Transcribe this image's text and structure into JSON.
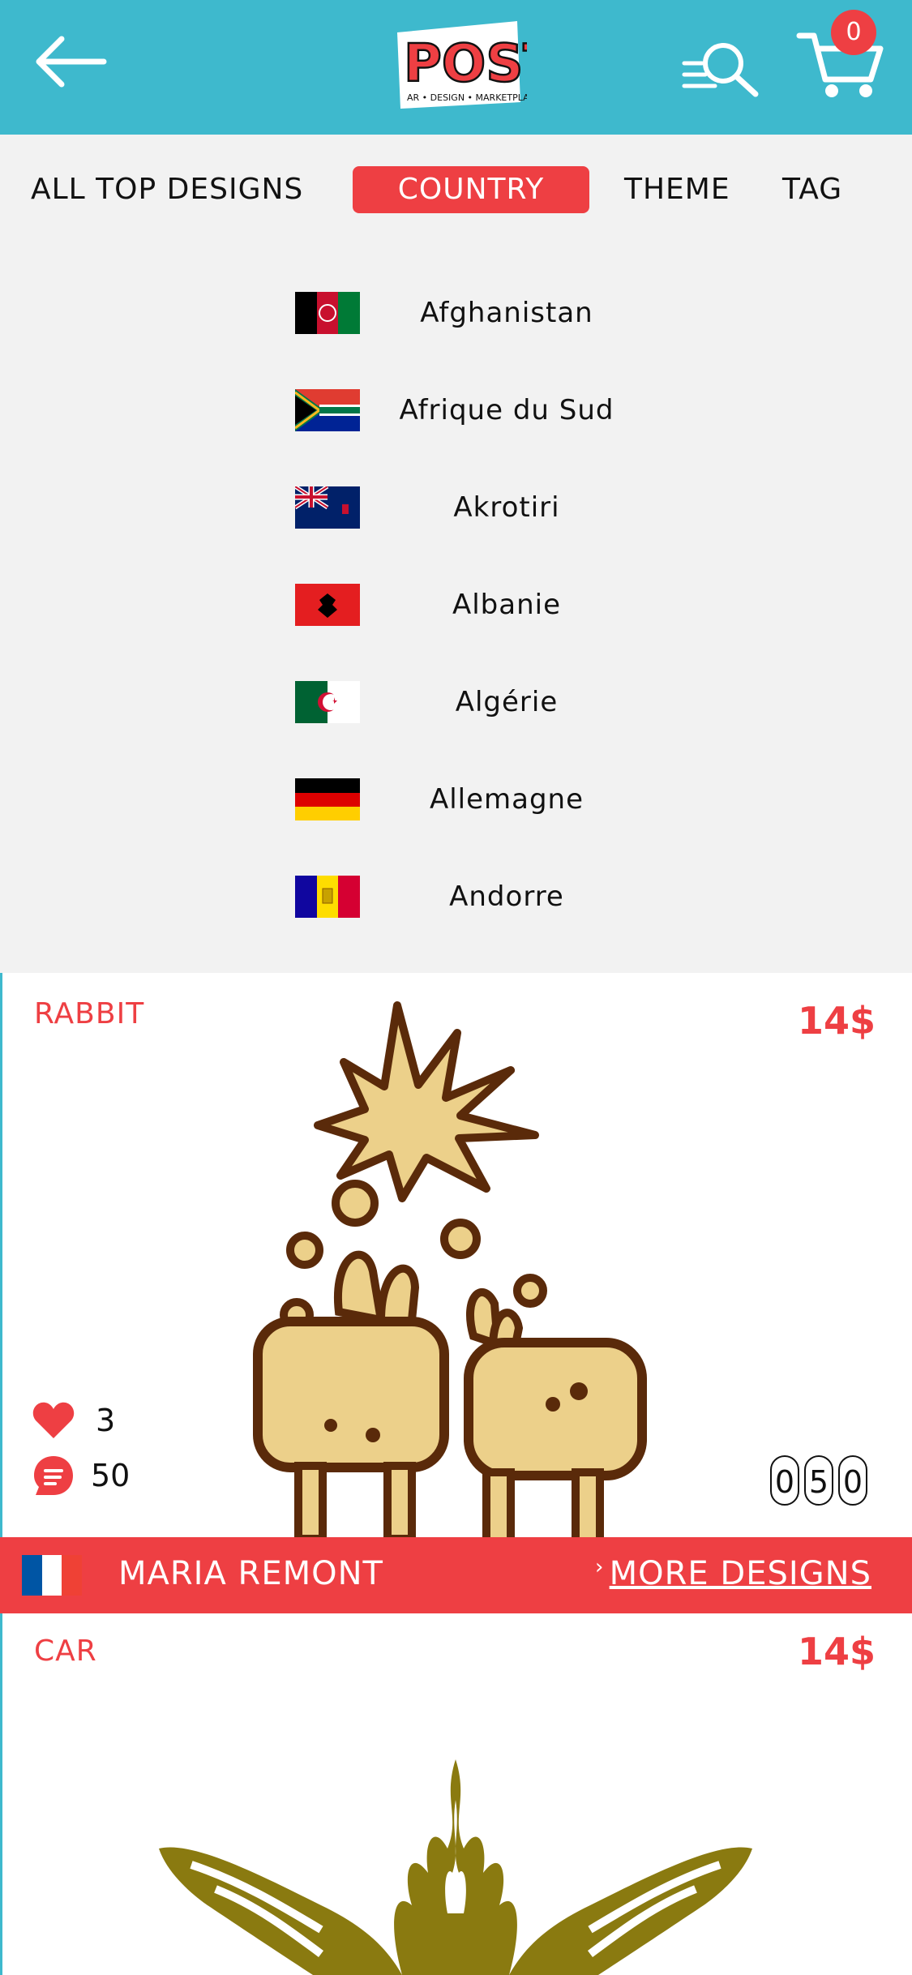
{
  "header": {
    "logo_text": "POST",
    "logo_tagline": "AR • DESIGN • MARKETPLACE",
    "cart_count": "0"
  },
  "tabs": [
    {
      "label": "ALL TOP DESIGNS",
      "active": false
    },
    {
      "label": "COUNTRY",
      "active": true
    },
    {
      "label": "THEME",
      "active": false
    },
    {
      "label": "TAG",
      "active": false
    }
  ],
  "countries": [
    {
      "name": "Afghanistan"
    },
    {
      "name": "Afrique du Sud"
    },
    {
      "name": "Akrotiri"
    },
    {
      "name": "Albanie"
    },
    {
      "name": "Algérie"
    },
    {
      "name": "Allemagne"
    },
    {
      "name": "Andorre"
    }
  ],
  "cards": [
    {
      "title": "RABBIT",
      "price": "14$",
      "likes": "3",
      "comments": "50",
      "counter_digits": [
        "0",
        "5",
        "0"
      ],
      "artist": "MARIA REMONT",
      "more_label": "MORE DESIGNS"
    },
    {
      "title": "CAR",
      "price": "14$"
    }
  ],
  "colors": {
    "header_bg": "#3eb9cd",
    "accent": "#ee3f43",
    "panel_bg": "#f2f2f2"
  }
}
